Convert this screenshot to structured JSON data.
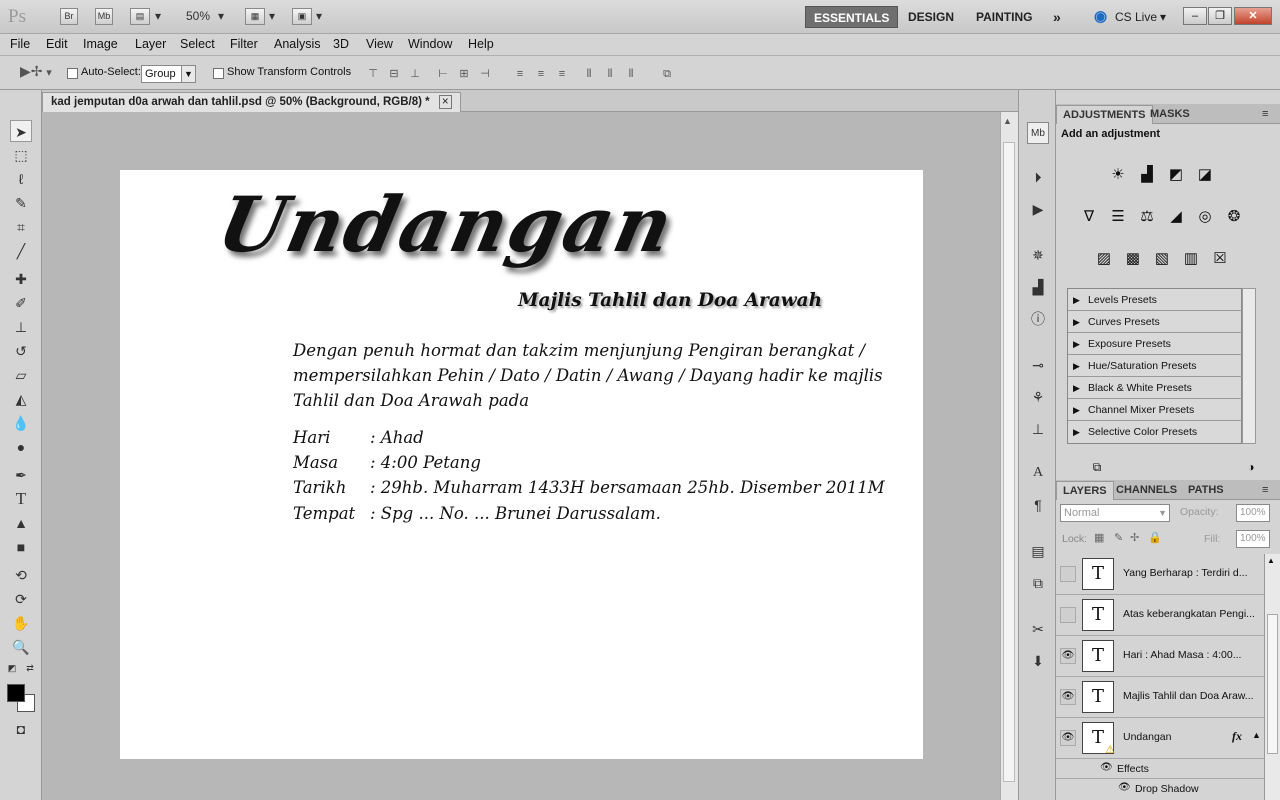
{
  "app": {
    "logo": "Ps",
    "bridge_label": "Br",
    "minibridge_label": "Mb",
    "zoom": "50%",
    "workspaces": [
      "ESSENTIALS",
      "DESIGN",
      "PAINTING"
    ],
    "more_workspaces": "»",
    "cs_live": "CS Live"
  },
  "menu": [
    "File",
    "Edit",
    "Image",
    "Layer",
    "Select",
    "Filter",
    "Analysis",
    "3D",
    "View",
    "Window",
    "Help"
  ],
  "options": {
    "auto_select_label": "Auto-Select:",
    "auto_select_value": "Group",
    "show_transform_label": "Show Transform Controls"
  },
  "document": {
    "tab_title": "kad jemputan d0a arwah dan tahlil.psd @ 50% (Background, RGB/8) *",
    "tab_close": "×",
    "script_title": "Undangan",
    "subtitle": "Majlis Tahlil dan Doa Arawah",
    "body_lines": [
      "Dengan penuh hormat dan takzim menjunjung Pengiran berangkat /",
      "mempersilahkan Pehin / Dato / Datin / Awang / Dayang hadir ke majlis",
      "Tahlil dan Doa Arawah pada"
    ],
    "details": [
      {
        "key": "Hari",
        "value": ": Ahad"
      },
      {
        "key": "Masa",
        "value": ": 4:00 Petang"
      },
      {
        "key": "Tarikh",
        "value": ": 29hb. Muharram 1433H bersamaan 25hb. Disember 2011M"
      },
      {
        "key": "Tempat",
        "value": ": Spg ... No. ...  Brunei Darussalam."
      }
    ]
  },
  "adjustments": {
    "tabs": [
      "ADJUSTMENTS",
      "MASKS"
    ],
    "heading": "Add an adjustment",
    "presets": [
      "Levels Presets",
      "Curves Presets",
      "Exposure Presets",
      "Hue/Saturation Presets",
      "Black & White Presets",
      "Channel Mixer Presets",
      "Selective Color Presets"
    ]
  },
  "layers": {
    "tabs": [
      "LAYERS",
      "CHANNELS",
      "PATHS"
    ],
    "blend_mode": "Normal",
    "opacity_label": "Opacity:",
    "opacity_value": "100%",
    "lock_label": "Lock:",
    "fill_label": "Fill:",
    "fill_value": "100%",
    "items": [
      {
        "name": "Yang Berharap : Terdiri d...",
        "visible": false
      },
      {
        "name": "Atas keberangkatan Pengi...",
        "visible": false
      },
      {
        "name": "Hari    : Ahad Masa    : 4:00...",
        "visible": true
      },
      {
        "name": "Majlis Tahlil dan Doa Araw...",
        "visible": true
      },
      {
        "name": "Undangan",
        "visible": true
      }
    ],
    "fx_label": "fx",
    "effects_label": "Effects",
    "drop_shadow_label": "Drop Shadow"
  }
}
